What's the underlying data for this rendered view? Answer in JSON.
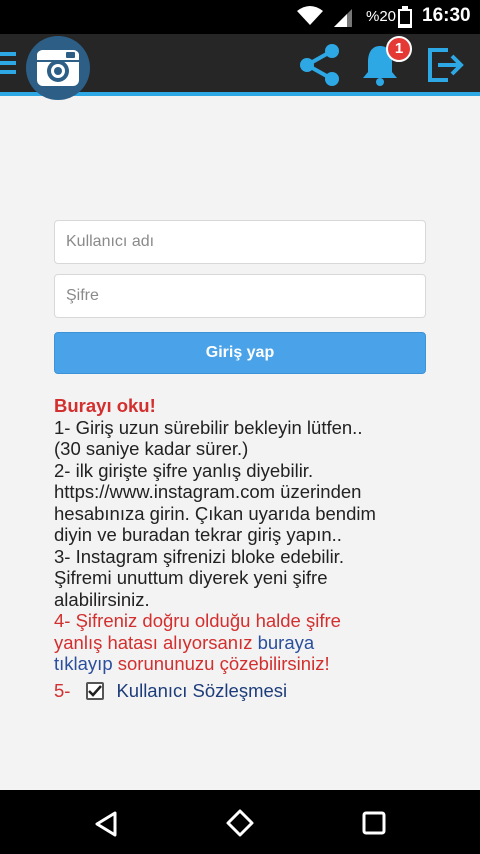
{
  "status_bar": {
    "battery_percent": "%20",
    "time": "16:30",
    "icons": [
      "wifi-icon",
      "signal-icon",
      "battery-icon"
    ]
  },
  "app_bar": {
    "icons": [
      "menu-icon",
      "instagram-logo-icon",
      "share-icon",
      "bell-icon",
      "logout-icon"
    ],
    "notification_count": "1",
    "accent_color": "#2ea8e4"
  },
  "login_form": {
    "username_placeholder": "Kullanıcı adı",
    "password_placeholder": "Şifre",
    "login_button": "Giriş yap"
  },
  "notice": {
    "heading": "Burayı oku!",
    "line1": "1- Giriş uzun sürebilir bekleyin lütfen..",
    "line2": "(30 saniye kadar sürer.)",
    "line3": "2- ilk girişte şifre yanlış diyebilir.",
    "line4": "https://www.instagram.com üzerinden",
    "line5": "hesabınıza girin. Çıkan uyarıda bendim",
    "line6": "diyin ve buradan tekrar giriş yapın..",
    "line7": "3- Instagram şifrenizi bloke edebilir.",
    "line8": "Şifremi unuttum diyerek yeni şifre",
    "line9": "alabilirsiniz.",
    "line10": "4- Şifreniz doğru olduğu halde şifre",
    "line11_red": "yanlış hatası alıyorsanız",
    "line11_link": "buraya",
    "line12_link": "tıklayıp",
    "line12_red": "sorununuzu çözebilirsiniz!"
  },
  "agreement": {
    "number": "5-",
    "checked": true,
    "label": "Kullanıcı Sözleşmesi"
  },
  "nav_bar": {
    "icons": [
      "back-icon",
      "home-icon",
      "recent-apps-icon"
    ]
  }
}
